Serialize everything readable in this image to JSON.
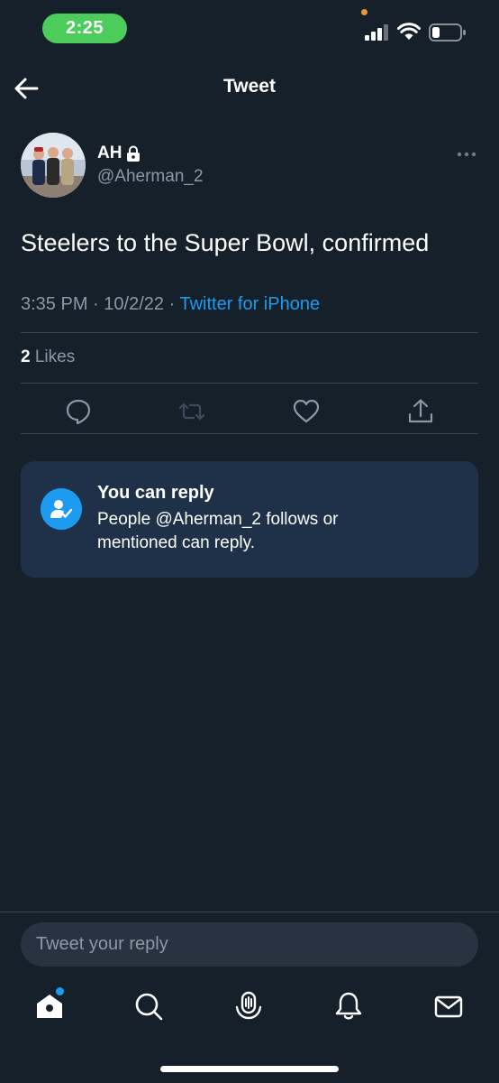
{
  "status_bar": {
    "time": "2:25"
  },
  "nav": {
    "title": "Tweet"
  },
  "author": {
    "name": "AH",
    "handle": "@Aherman_2"
  },
  "tweet": {
    "text": "Steelers to the Super Bowl, confirmed",
    "time": "3:35 PM",
    "date": "10/2/22",
    "source": "Twitter for iPhone",
    "likes_count": "2",
    "likes_label": "Likes"
  },
  "reply_notice": {
    "title": "You can reply",
    "body": "People @Aherman_2 follows or mentioned can reply."
  },
  "compose": {
    "placeholder": "Tweet your reply"
  },
  "icons": {
    "back": "arrow-left-icon",
    "lock": "lock-icon",
    "more": "more-horizontal-icon",
    "reply": "comment-icon",
    "retweet": "retweet-icon",
    "like": "heart-icon",
    "share": "share-icon",
    "tabs": [
      "home-icon",
      "search-icon",
      "spaces-icon",
      "notifications-icon",
      "messages-icon"
    ]
  },
  "colors": {
    "background": "#15202b",
    "accent": "#1d9bf0",
    "secondary_text": "#8b98a5",
    "status_pill": "#4ccd5b",
    "card": "#1e3148"
  }
}
